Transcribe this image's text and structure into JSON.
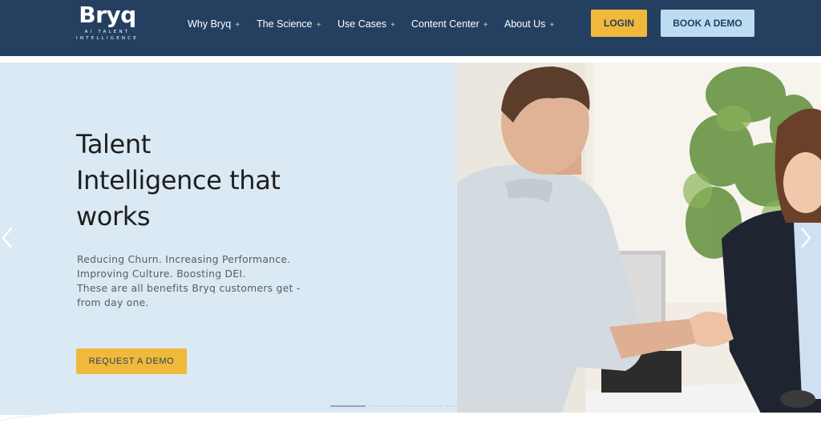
{
  "header": {
    "logo": {
      "word": "Bryq",
      "tagline": "AI TALENT INTELLIGENCE"
    },
    "nav": [
      {
        "label": "Why Bryq",
        "expand": "+"
      },
      {
        "label": "The Science",
        "expand": "+"
      },
      {
        "label": "Use Cases",
        "expand": "+"
      },
      {
        "label": "Content Center",
        "expand": "+"
      },
      {
        "label": "About Us",
        "expand": "+"
      }
    ],
    "login_label": "LOGIN",
    "demo_label": "BOOK A DEMO"
  },
  "hero": {
    "headline_lines": [
      "Talent",
      "Intelligence that",
      "works"
    ],
    "sub_lines": [
      "Reducing Churn. Increasing Performance.",
      "Improving Culture. Boosting DEI.",
      "These are all benefits Bryq customers get -",
      "from day one."
    ],
    "cta_label": "REQUEST A DEMO",
    "image_description_icon": "handshake-photo",
    "carousel": {
      "slides": 4,
      "active_index": 0
    }
  },
  "colors": {
    "header_bg": "#253f61",
    "accent_yellow": "#f0b93b",
    "accent_light_blue": "#bcdcf2",
    "hero_bg": "#dae9f3"
  }
}
